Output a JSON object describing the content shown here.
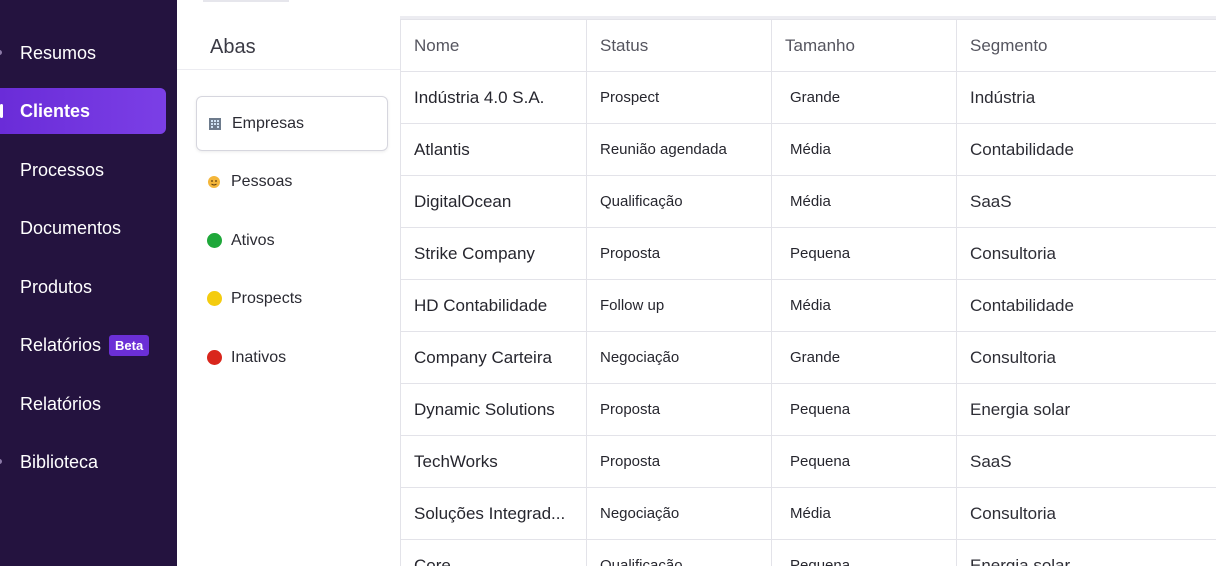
{
  "sidebar": {
    "items": [
      {
        "label": "Resumos",
        "active": false
      },
      {
        "label": "Clientes",
        "active": true
      },
      {
        "label": "Processos",
        "active": false
      },
      {
        "label": "Documentos",
        "active": false
      },
      {
        "label": "Produtos",
        "active": false
      },
      {
        "label": "Relatórios",
        "active": false,
        "badge": "Beta"
      },
      {
        "label": "Relatórios",
        "active": false
      },
      {
        "label": "Biblioteca",
        "active": false
      }
    ],
    "colors": {
      "background": "#24133f",
      "active": "#7b3fe6"
    }
  },
  "tabs": {
    "title": "Abas",
    "items": [
      {
        "label": "Empresas",
        "icon": "building-icon",
        "active": true
      },
      {
        "label": "Pessoas",
        "icon": "person-icon",
        "active": false
      },
      {
        "label": "Ativos",
        "icon": "green-circle-icon",
        "color": "#1fa83a",
        "active": false
      },
      {
        "label": "Prospects",
        "icon": "yellow-circle-icon",
        "color": "#f4cc0f",
        "active": false
      },
      {
        "label": "Inativos",
        "icon": "red-circle-icon",
        "color": "#d9261c",
        "active": false
      }
    ]
  },
  "table": {
    "columns": [
      "Nome",
      "Status",
      "Tamanho",
      "Segmento"
    ],
    "rows": [
      [
        "Indústria 4.0 S.A.",
        "Prospect",
        "Grande",
        "Indústria"
      ],
      [
        "Atlantis",
        "Reunião agendada",
        "Média",
        "Contabilidade"
      ],
      [
        "DigitalOcean",
        "Qualificação",
        "Média",
        "SaaS"
      ],
      [
        "Strike Company",
        "Proposta",
        "Pequena",
        "Consultoria"
      ],
      [
        "HD Contabilidade",
        "Follow up",
        "Média",
        "Contabilidade"
      ],
      [
        "Company Carteira",
        "Negociação",
        "Grande",
        "Consultoria"
      ],
      [
        "Dynamic Solutions",
        "Proposta",
        "Pequena",
        "Energia solar"
      ],
      [
        "TechWorks",
        "Proposta",
        "Pequena",
        "SaaS"
      ],
      [
        "Soluções Integrad...",
        "Negociação",
        "Média",
        "Consultoria"
      ],
      [
        "Core",
        "Qualificação",
        "Pequena",
        "Energia solar"
      ]
    ]
  }
}
